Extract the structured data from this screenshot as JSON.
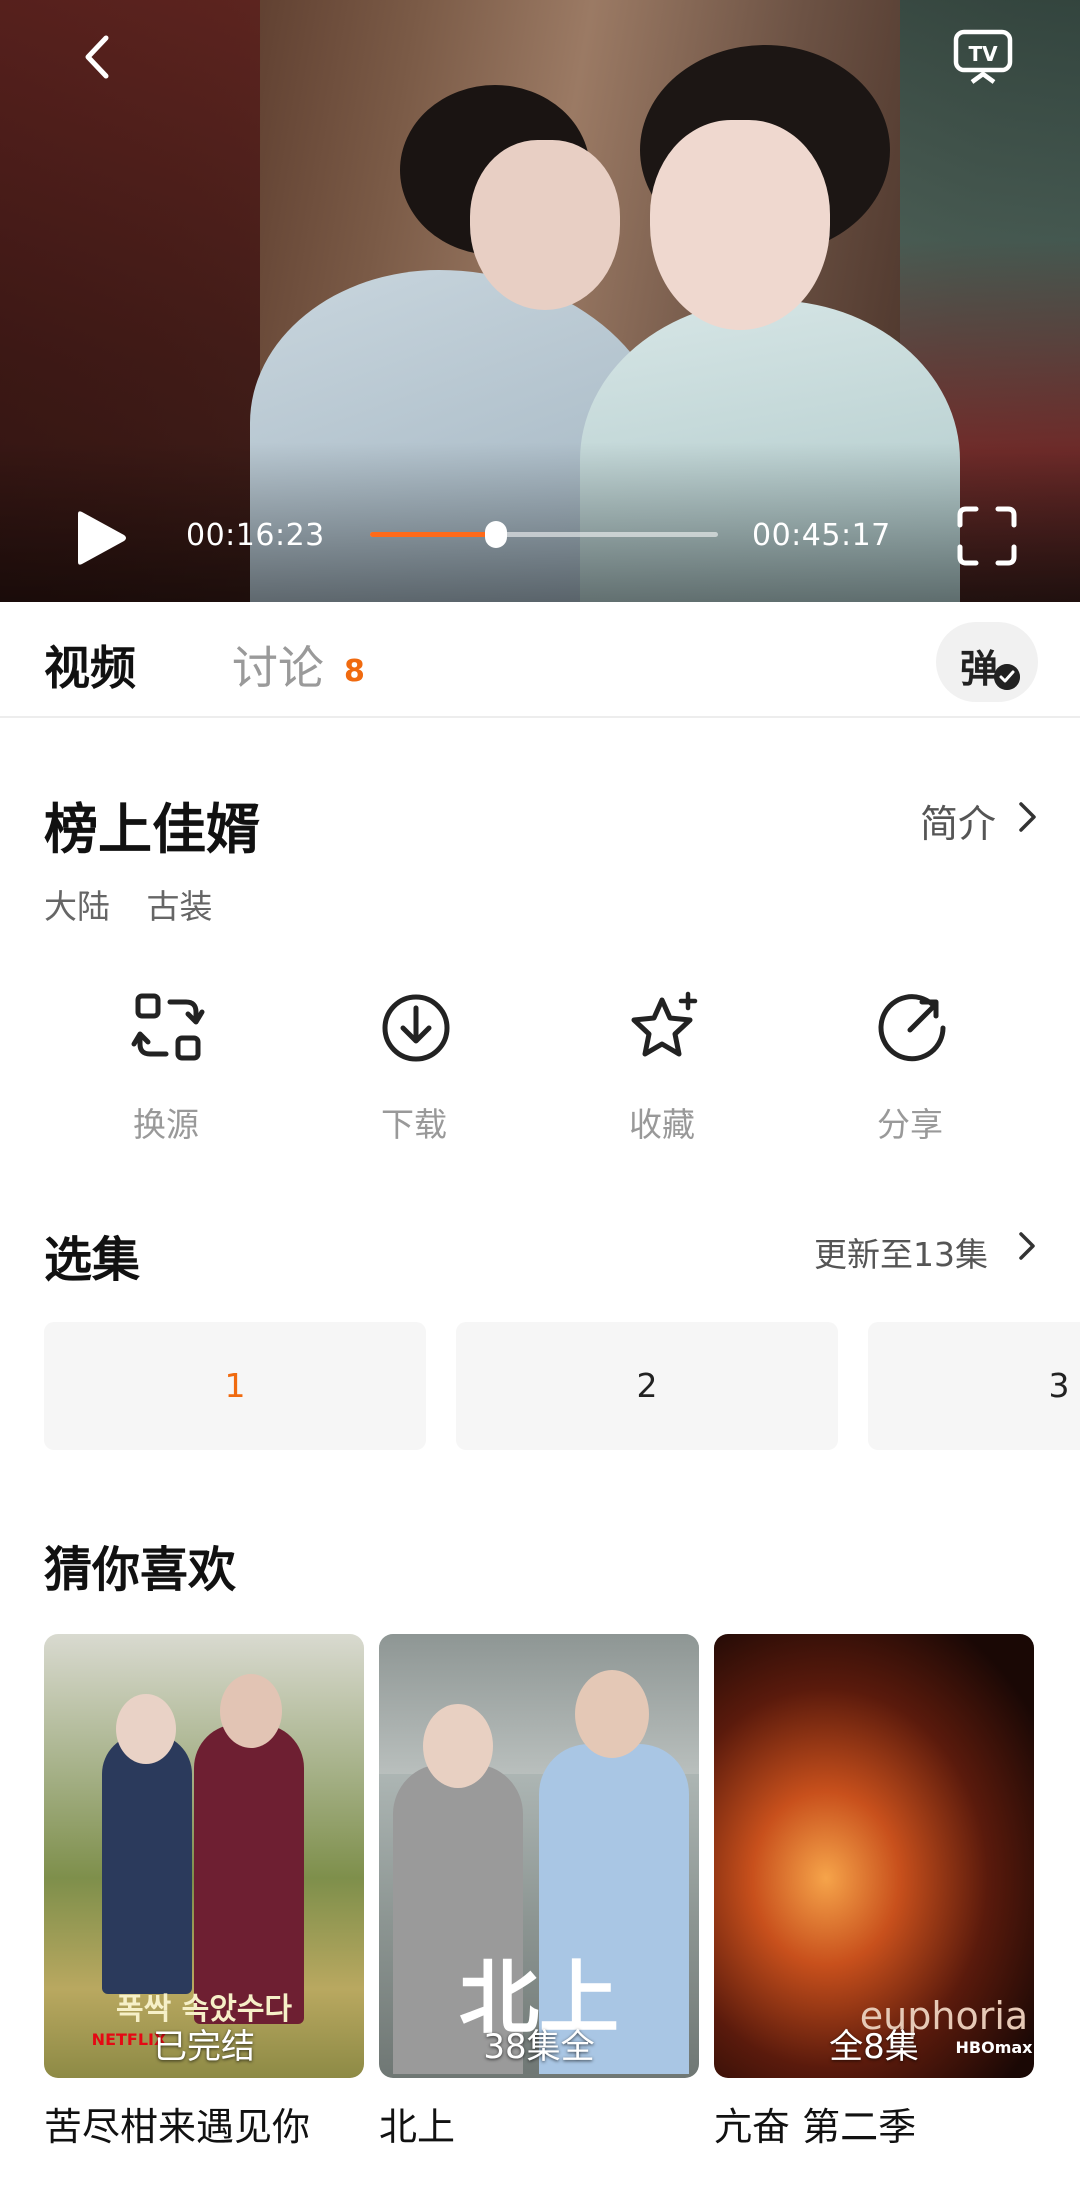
{
  "player": {
    "current_time": "00:16:23",
    "total_time": "00:45:17",
    "progress": 0.362,
    "accent_color": "#ff6a1a"
  },
  "tabs": [
    {
      "label": "视频",
      "active": true
    },
    {
      "label": "讨论",
      "badge": "8"
    }
  ],
  "danmu_label": "弹",
  "show": {
    "title": "榜上佳婿",
    "intro_label": "简介",
    "tags": [
      "大陆",
      "古装"
    ]
  },
  "actions": [
    {
      "label": "换源",
      "icon": "switch-source-icon"
    },
    {
      "label": "下载",
      "icon": "download-icon"
    },
    {
      "label": "收藏",
      "icon": "favorite-star-icon"
    },
    {
      "label": "分享",
      "icon": "share-icon"
    }
  ],
  "episodes": {
    "title": "选集",
    "update_label": "更新至13集",
    "items": [
      "1",
      "2",
      "3"
    ],
    "selected": "1",
    "accent_color": "#f06a0f"
  },
  "recommend": {
    "title": "猜你喜欢",
    "items": [
      {
        "name": "苦尽柑来遇见你",
        "badge": "已完结",
        "poster_text": "폭싹 속았수다",
        "poster_brand": "NETFLIX"
      },
      {
        "name": "北上",
        "badge": "38集全",
        "poster_text": "北上"
      },
      {
        "name": "亢奋 第二季",
        "badge": "全8集",
        "poster_text": "euphoria",
        "poster_brand": "HBOmax"
      }
    ]
  }
}
